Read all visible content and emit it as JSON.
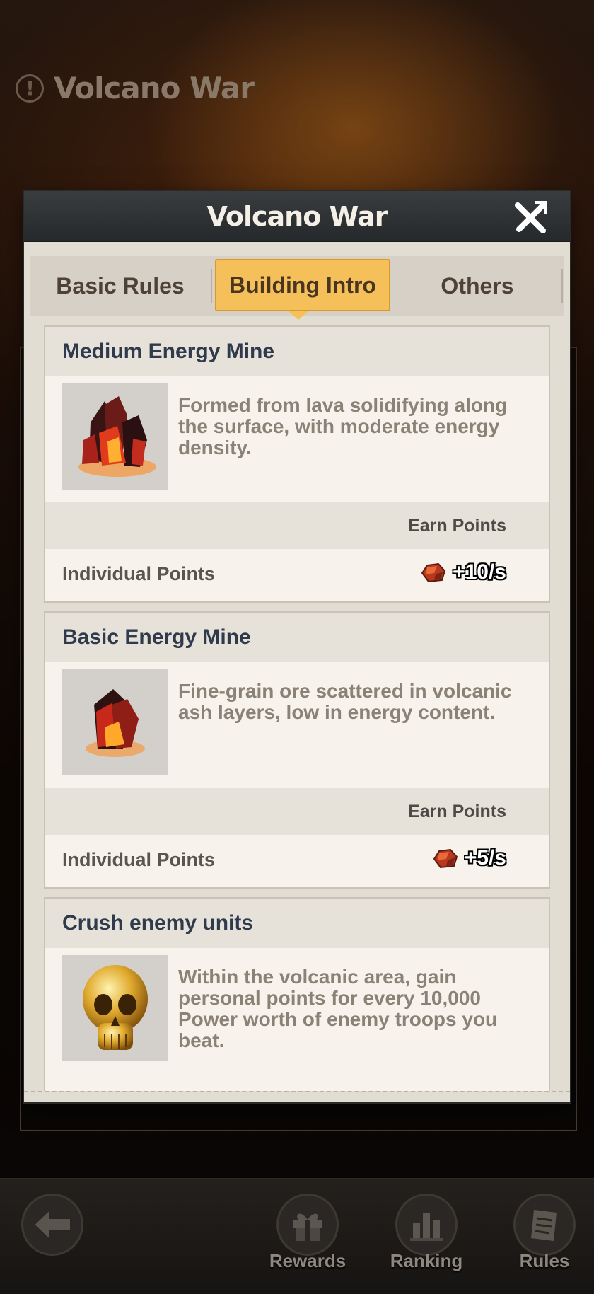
{
  "background_title": "Volcano War",
  "modal": {
    "title": "Volcano War",
    "tabs": [
      {
        "label": "Basic Rules",
        "active": false
      },
      {
        "label": "Building Intro",
        "active": true
      },
      {
        "label": "Others",
        "active": false
      }
    ]
  },
  "cards": [
    {
      "title": "Medium Energy Mine",
      "description": "Formed from lava solidifying along the surface, with moderate energy density.",
      "earn_label": "Earn Points",
      "points_label": "Individual Points",
      "points_value": "+10/s",
      "icon": "red-crystal-cluster-icon"
    },
    {
      "title": "Basic Energy Mine",
      "description": "Fine-grain ore scattered in volcanic ash layers, low in energy content.",
      "earn_label": "Earn Points",
      "points_label": "Individual Points",
      "points_value": "+5/s",
      "icon": "red-crystal-icon"
    },
    {
      "title": "Crush enemy units",
      "description": "Within the volcanic area, gain personal points for every 10,000 Power worth of enemy troops you beat.",
      "icon": "golden-skull-icon"
    }
  ],
  "bottom_nav": {
    "back_icon": "back-arrow-icon",
    "items": [
      {
        "label": "Rewards",
        "icon": "gift-icon"
      },
      {
        "label": "Ranking",
        "icon": "ranking-bars-icon"
      },
      {
        "label": "Rules",
        "icon": "document-icon"
      }
    ]
  },
  "colors": {
    "active_tab": "#f5c05a",
    "header_bg": "#2e3133",
    "card_title": "#2f3a4c"
  }
}
